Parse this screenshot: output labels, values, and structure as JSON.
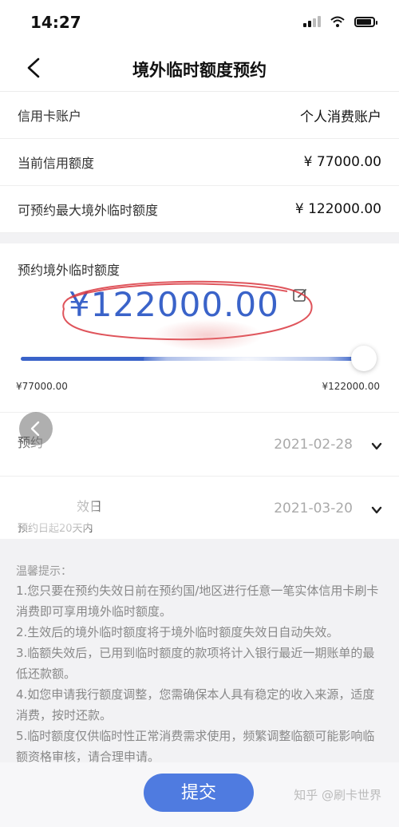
{
  "status_bar": {
    "time": "14:27"
  },
  "nav": {
    "title": "境外临时额度预约"
  },
  "info": [
    {
      "label": "信用卡账户",
      "value": "个人消费账户"
    },
    {
      "label": "当前信用额度",
      "value": "¥ 77000.00"
    },
    {
      "label": "可预约最大境外临时额度",
      "value": "¥ 122000.00"
    }
  ],
  "amount": {
    "label": "预约境外临时额度",
    "value": "¥122000.00",
    "slider_min": "¥77000.00",
    "slider_max": "¥122000.00",
    "slider_level": 1.0
  },
  "dates": [
    {
      "label": "预约",
      "value": "2021-02-28"
    },
    {
      "label": "效日",
      "value": "2021-03-20",
      "sub": "预约日起20天内"
    }
  ],
  "tips": {
    "title": "温馨提示：",
    "items": [
      "1.您只要在预约失效日前在预约国/地区进行任意一笔实体信用卡刷卡消费即可享用境外临时额度。",
      "2.生效后的境外临时额度将于境外临时额度失效日自动失效。",
      "3.临额失效后，已用到临时额度的款项将计入银行最近一期账单的最低还款额。",
      "4.如您申请我行额度调整，您需确保本人具有稳定的收入来源，适度消费，按时还款。",
      "5.临时额度仅供临时性正常消费需求使用，频繁调整临额可能影响临额资格审核，请合理申请。"
    ]
  },
  "submit": {
    "label": "提交"
  },
  "watermark": "知乎 @刷卡世界",
  "colors": {
    "accent": "#3a63c9",
    "button": "#4f7be0",
    "annotation": "#d9363e"
  }
}
